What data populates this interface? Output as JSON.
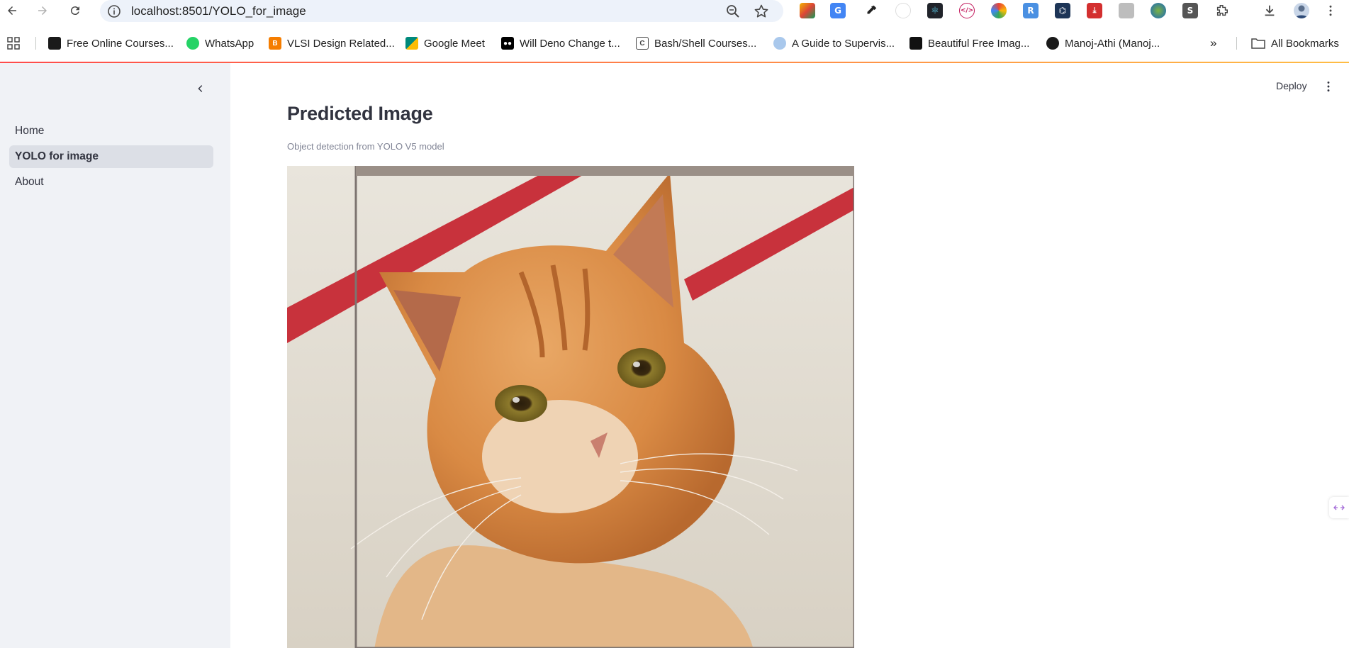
{
  "browser": {
    "url": "localhost:8501/YOLO_for_image",
    "bookmarks": [
      {
        "label": "Free Online Courses...",
        "color": "#1a1a1a"
      },
      {
        "label": "WhatsApp",
        "color": "#25d366"
      },
      {
        "label": "VLSI Design Related...",
        "color": "#f57d00"
      },
      {
        "label": "Google Meet",
        "color": "#00897b"
      },
      {
        "label": "Will Deno Change t...",
        "color": "#000000"
      },
      {
        "label": "Bash/Shell Courses...",
        "color": "#444444"
      },
      {
        "label": "A Guide to Supervis...",
        "color": "#5a9bd5"
      },
      {
        "label": "Beautiful Free Imag...",
        "color": "#111111"
      },
      {
        "label": "Manoj-Athi (Manoj...",
        "color": "#1a1a1a"
      }
    ],
    "all_bookmarks_label": "All Bookmarks"
  },
  "app": {
    "sidebar": {
      "items": [
        {
          "label": "Home",
          "active": false
        },
        {
          "label": "YOLO for image",
          "active": true
        },
        {
          "label": "About",
          "active": false
        }
      ]
    },
    "header": {
      "deploy_label": "Deploy"
    },
    "main": {
      "title": "Predicted Image",
      "caption": "Object detection from YOLO V5 model"
    }
  },
  "colors": {
    "accent": "#ff4b4b",
    "sidebar_bg": "#f0f2f6",
    "active_item_bg": "#dcdfe6",
    "bbox": "#7d7470"
  }
}
